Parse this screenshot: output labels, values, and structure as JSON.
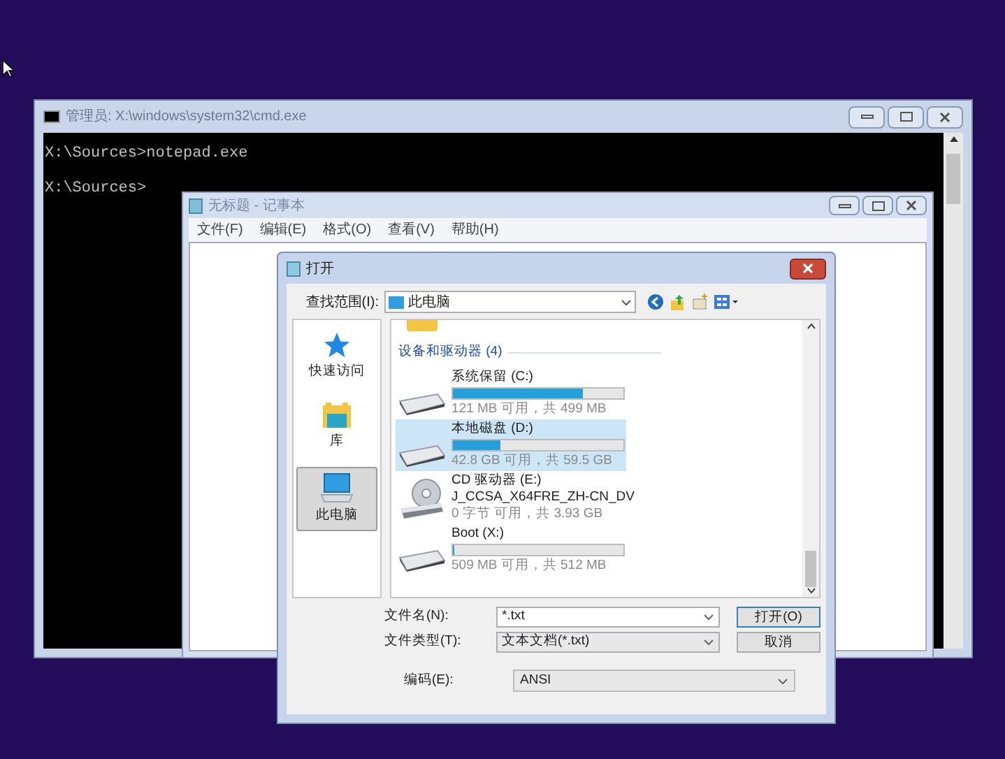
{
  "cmd_window": {
    "title": "管理员: X:\\windows\\system32\\cmd.exe",
    "lines": [
      "X:\\Sources>notepad.exe",
      "X:\\Sources>"
    ]
  },
  "notepad": {
    "title": "无标题 - 记事本",
    "menu": [
      "文件(F)",
      "编辑(E)",
      "格式(O)",
      "查看(V)",
      "帮助(H)"
    ]
  },
  "open_dialog": {
    "title": "打开",
    "look_in": {
      "label": "查找范围(I):",
      "value": "此电脑"
    },
    "sidebar": [
      {
        "label": "快速访问",
        "selected": false
      },
      {
        "label": "库",
        "selected": false
      },
      {
        "label": "此电脑",
        "selected": true
      }
    ],
    "group": "设备和驱动器 (4)",
    "drives": [
      {
        "kind": "disk",
        "name": "系统保留 (C:)",
        "level": 0.76,
        "info": "121 MB 可用，共 499 MB",
        "selected": false
      },
      {
        "kind": "disk",
        "name": "本地磁盘 (D:)",
        "level": 0.28,
        "info": "42.8 GB 可用，共 59.5 GB",
        "selected": true
      },
      {
        "kind": "cd",
        "name": "CD 驱动器 (E:)",
        "label": "J_CCSA_X64FRE_ZH-CN_DV",
        "info": "0 字节 可用，共 3.93 GB",
        "selected": false
      },
      {
        "kind": "disk",
        "name": "Boot (X:)",
        "level": 0.006,
        "info": "509 MB 可用，共 512 MB",
        "selected": false
      }
    ],
    "file_name": {
      "label": "文件名(N):",
      "value": "*.txt"
    },
    "file_type": {
      "label": "文件类型(T):",
      "value": "文本文档(*.txt)"
    },
    "encoding": {
      "label": "编码(E):",
      "value": "ANSI"
    },
    "buttons": [
      "打开(O)",
      "取消"
    ]
  }
}
